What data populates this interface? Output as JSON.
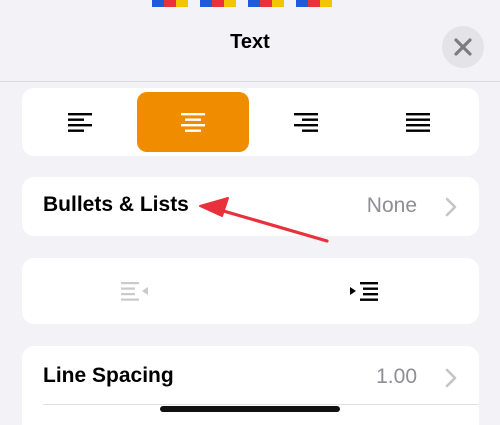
{
  "header": {
    "title": "Text",
    "close_icon": "close-icon"
  },
  "alignment": {
    "options": [
      {
        "name": "align-left",
        "icon": "align-left-icon",
        "active": false
      },
      {
        "name": "align-center",
        "icon": "align-center-icon",
        "active": true
      },
      {
        "name": "align-right",
        "icon": "align-right-icon",
        "active": false
      },
      {
        "name": "align-justify",
        "icon": "align-justify-icon",
        "active": false
      }
    ],
    "accent_color": "#f08c00"
  },
  "bullets": {
    "label": "Bullets & Lists",
    "value": "None"
  },
  "indent": {
    "decrease_icon": "decrease-indent-icon",
    "increase_icon": "increase-indent-icon"
  },
  "line_spacing": {
    "label": "Line Spacing",
    "value": "1.00"
  },
  "annotation": {
    "arrow_color": "#e8313a"
  }
}
